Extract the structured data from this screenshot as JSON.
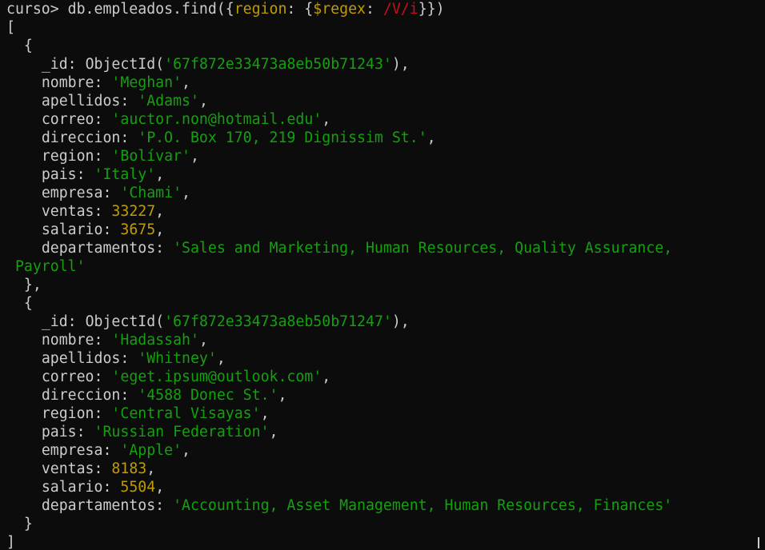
{
  "terminal": {
    "prompt": "curso>",
    "command_prefix": " db.empleados.find({",
    "command_field": "region",
    "command_colon": ": {",
    "command_op": "$regex",
    "command_colon2": ": ",
    "command_regex": "/V/i",
    "command_suffix": "}})"
  },
  "results": [
    {
      "id": "67f872e33473a8eb50b71243",
      "nombre": "Meghan",
      "apellidos": "Adams",
      "correo": "auctor.non@hotmail.edu",
      "direccion": "P.O. Box 170, 219 Dignissim St.",
      "region": "Bolívar",
      "pais": "Italy",
      "empresa": "Chami",
      "ventas": "33227",
      "salario": "3675",
      "departamentos_line1": "'Sales and Marketing, Human Resources, Quality Assurance,",
      "departamentos_line2": "Payroll'"
    },
    {
      "id": "67f872e33473a8eb50b71247",
      "nombre": "Hadassah",
      "apellidos": "Whitney",
      "correo": "eget.ipsum@outlook.com",
      "direccion": "4588 Donec St.",
      "region": "Central Visayas",
      "pais": "Russian Federation",
      "empresa": "Apple",
      "ventas": "8183",
      "salario": "5504",
      "departamentos": "Accounting, Asset Management, Human Resources, Finances"
    }
  ],
  "keys": {
    "id": "_id",
    "objectid": "ObjectId",
    "nombre": "nombre",
    "apellidos": "apellidos",
    "correo": "correo",
    "direccion": "direccion",
    "region": "region",
    "pais": "pais",
    "empresa": "empresa",
    "ventas": "ventas",
    "salario": "salario",
    "departamentos": "departamentos"
  }
}
